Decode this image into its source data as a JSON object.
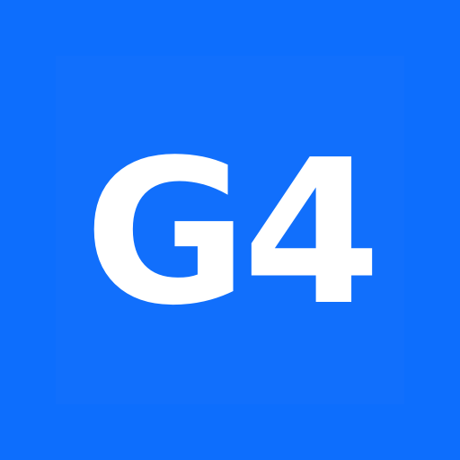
{
  "logo": {
    "text": "G4",
    "background_color": "#0d6efd",
    "inner_square_color": "#116ffc",
    "text_color": "#ffffff"
  }
}
